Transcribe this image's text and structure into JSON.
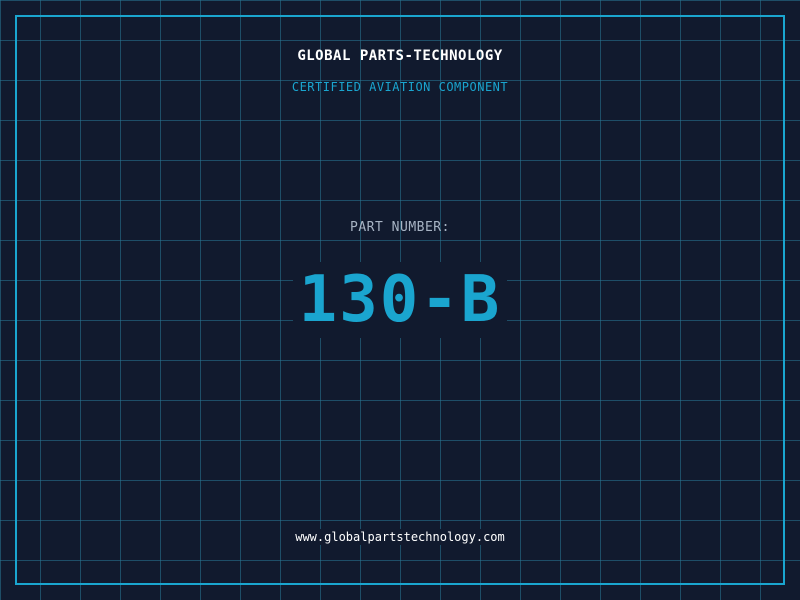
{
  "header": {
    "brand": "GLOBAL PARTS-TECHNOLOGY",
    "tagline": "CERTIFIED AVIATION COMPONENT"
  },
  "part": {
    "label": "PART NUMBER:",
    "number": "130-B"
  },
  "footer": {
    "url": "www.globalpartstechnology.com"
  },
  "colors": {
    "background": "#111a2e",
    "accent": "#1aa5cf",
    "grid": "#287896",
    "text": "#ffffff",
    "label": "#a8b4c4"
  }
}
